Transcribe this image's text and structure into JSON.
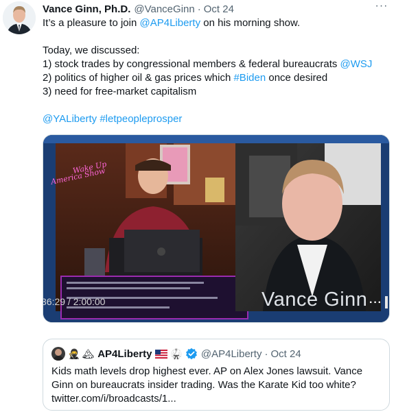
{
  "author": {
    "name": "Vance Ginn, Ph.D.",
    "handle": "@VanceGinn",
    "separator": "·",
    "time": "Oct 24",
    "avatar_icon": "profile-photo-man-in-suit"
  },
  "more_icon": "···",
  "tweet": {
    "line1": {
      "prefix": "It’s a pleasure to join ",
      "mention": "@AP4Liberty",
      "suffix": " on his morning show."
    },
    "line2": "Today, we discussed:",
    "line3": {
      "text": "1) stock trades by congressional members & federal bureaucrats ",
      "mention": "@WSJ"
    },
    "line4": {
      "prefix": "2) politics of higher oil & gas prices which ",
      "hashtag": "#Biden",
      "suffix": " once desired"
    },
    "line5": "3) need for free-market capitalism",
    "line6": {
      "mention": "@YALiberty",
      "space": " ",
      "hashtag": "#letpeopleprosper"
    }
  },
  "video": {
    "time": "36:29 / 2:00:00",
    "name_overlay": "Vance Ginn",
    "show_logo": "Wake Up America Show",
    "more_icon": "···"
  },
  "quote": {
    "emojis": [
      "🥷",
      "🏔"
    ],
    "name": "AP4Liberty",
    "flag_icon": "us-flag-icon",
    "karate_icon": "🥋",
    "verified_icon": "verified-badge-icon",
    "handle": "@AP4Liberty",
    "separator": "·",
    "time": "Oct 24",
    "text": "Kids math levels drop highest ever. AP on Alex Jones lawsuit. Vance Ginn on bureaucrats insider trading. Was the Karate Kid too white? twitter.com/i/broadcasts/1..."
  },
  "colors": {
    "link": "#1d9bf0",
    "text": "#0f1419",
    "secondary": "#536471",
    "border": "#cfd9de"
  }
}
